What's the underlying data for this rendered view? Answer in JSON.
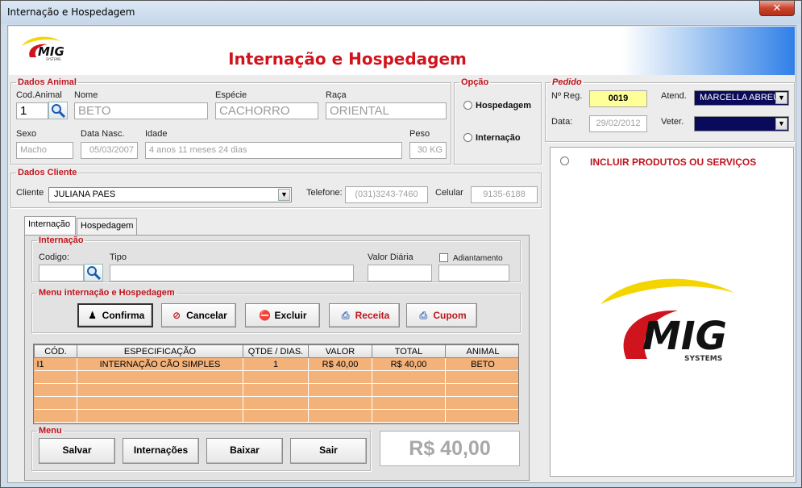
{
  "window": {
    "title": "Internação e Hospedagem",
    "close_glyph": "✕"
  },
  "header": {
    "title": "Internação e Hospedagem",
    "logo_text": "MIG",
    "logo_sub": "SYSTEMS"
  },
  "animal": {
    "legend": "Dados Animal",
    "cod_label": "Cod.Animal",
    "cod_value": "1",
    "nome_label": "Nome",
    "nome_value": "BETO",
    "especie_label": "Espécie",
    "especie_value": "CACHORRO",
    "raca_label": "Raça",
    "raca_value": "ORIENTAL",
    "sexo_label": "Sexo",
    "sexo_value": "Macho",
    "nasc_label": "Data Nasc.",
    "nasc_value": "05/03/2007",
    "idade_label": "Idade",
    "idade_value": "4 anos 11 meses 24 dias",
    "peso_label": "Peso",
    "peso_value": "30 KG"
  },
  "opcao": {
    "legend": "Opção",
    "hospedagem": "Hospedagem",
    "internacao": "Internação"
  },
  "pedido": {
    "legend": "Pedido",
    "nreg_label": "Nº Reg.",
    "nreg_value": "0019",
    "atend_label": "Atend.",
    "atend_value": "MARCELLA ABREU",
    "data_label": "Data:",
    "data_value": "29/02/2012",
    "veter_label": "Veter.",
    "veter_value": ""
  },
  "cliente": {
    "legend": "Dados Cliente",
    "cliente_label": "Cliente",
    "cliente_value": "JULIANA PAES",
    "telefone_label": "Telefone:",
    "telefone_value": "(031)3243-7460",
    "celular_label": "Celular",
    "celular_value": "9135-6188"
  },
  "tabs": [
    {
      "label": "Internação"
    },
    {
      "label": "Hospedagem"
    }
  ],
  "internacao": {
    "legend": "Internação",
    "codigo_label": "Codigo:",
    "codigo_value": "",
    "tipo_label": "Tipo",
    "tipo_value": "",
    "valor_label": "Valor Diária",
    "valor_value": "",
    "adiant_label": "Adiantamento",
    "adiant_value": ""
  },
  "menu_int": {
    "legend": "Menu internação e Hospedagem",
    "confirma": "Confirma",
    "cancelar": "Cancelar",
    "excluir": "Excluir",
    "receita": "Receita",
    "cupom": "Cupom"
  },
  "table": {
    "headers": [
      "CÓD.",
      "ESPECIFICAÇÃO",
      "QTDE / DIAS.",
      "VALOR",
      "TOTAL",
      "ANIMAL"
    ],
    "rows": [
      [
        "I1",
        "INTERNAÇÃO CÃO SIMPLES",
        "1",
        "R$ 40,00",
        "R$ 40,00",
        "BETO"
      ]
    ]
  },
  "menu": {
    "legend": "Menu",
    "salvar": "Salvar",
    "internacoes": "Internações",
    "baixar": "Baixar",
    "sair": "Sair"
  },
  "total": "R$ 40,00",
  "right_panel": {
    "incluir_label": "INCLUIR PRODUTOS OU SERVIÇOS",
    "logo_text": "MIG",
    "logo_sub": "SYSTEMS"
  },
  "colors": {
    "accent_red": "#c0141c",
    "grid_orange": "#f3b27a",
    "nreg_yellow": "#ffff99",
    "combo_navy": "#0a0a5a"
  },
  "icons": [
    "search-icon",
    "people-icon",
    "cancel-icon",
    "delete-icon",
    "printer-icon",
    "logo-swoosh"
  ]
}
